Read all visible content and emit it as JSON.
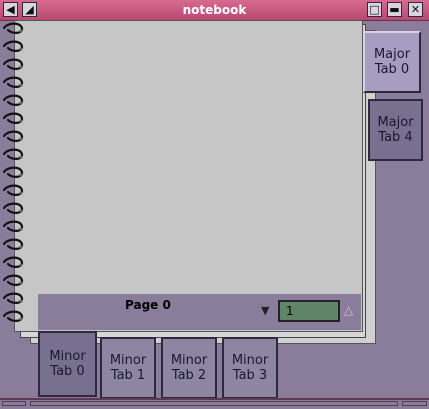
{
  "window": {
    "title": "notebook"
  },
  "notebook": {
    "page_label": "Page 0",
    "page_number": "1",
    "major_tabs": [
      {
        "line1": "Major",
        "line2": "Tab 0"
      },
      {
        "line1": "Major",
        "line2": "Tab 4"
      }
    ],
    "minor_tabs": [
      {
        "line1": "Minor",
        "line2": "Tab 0"
      },
      {
        "line1": "Minor",
        "line2": "Tab 1"
      },
      {
        "line1": "Minor",
        "line2": "Tab 2"
      },
      {
        "line1": "Minor",
        "line2": "Tab 3"
      }
    ]
  },
  "colors": {
    "titlebar": "#c85a82",
    "background": "#8a7d9c",
    "page": "#c6c6c6",
    "page_number_field": "#5f8468"
  }
}
